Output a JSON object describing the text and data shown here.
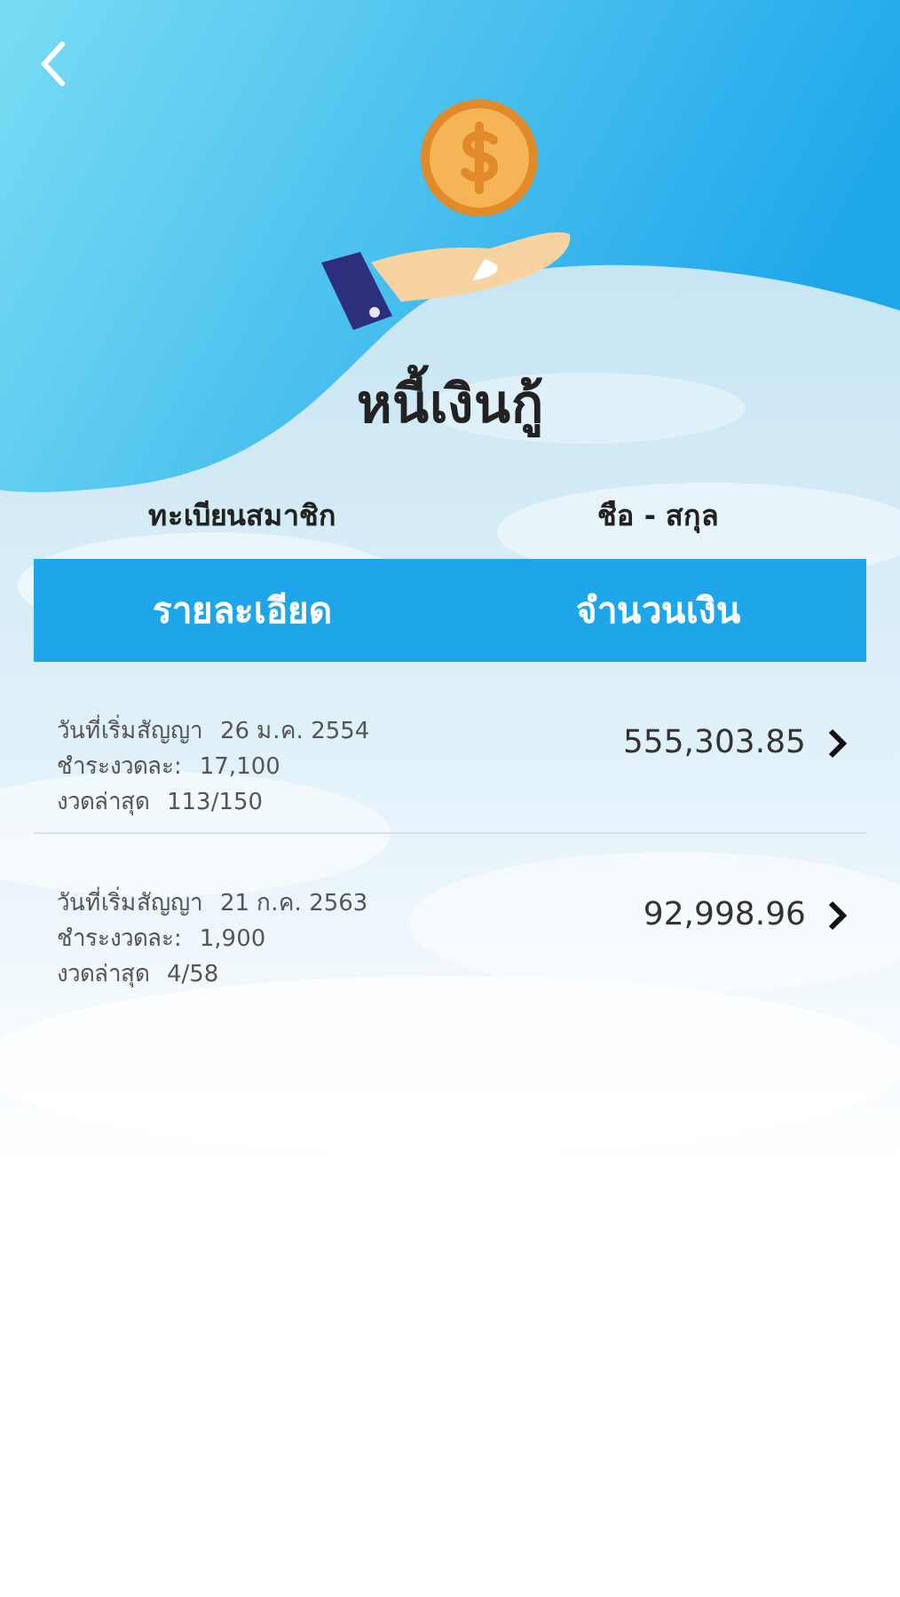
{
  "title": "หนี้เงินกู้",
  "member": {
    "id_label": "ทะเบียนสมาชิก",
    "name_label": "ชือ - สกุล"
  },
  "table": {
    "columns": [
      "รายละเอียด",
      "จำนวนเงิน"
    ],
    "rows": [
      {
        "details": [
          {
            "label": "วันที่เริ่มสัญญา",
            "value": "26 ม.ค. 2554"
          },
          {
            "label": "ชำระงวดละ:",
            "value": "17,100"
          },
          {
            "label": "งวดล่าสุด",
            "value": "113/150"
          }
        ],
        "amount": "555,303.85"
      },
      {
        "details": [
          {
            "label": "วันที่เริ่มสัญญา",
            "value": "21 ก.ค. 2563"
          },
          {
            "label": "ชำระงวดละ:",
            "value": "1,900"
          },
          {
            "label": "งวดล่าสุด",
            "value": "4/58"
          }
        ],
        "amount": "92,998.96"
      }
    ]
  }
}
